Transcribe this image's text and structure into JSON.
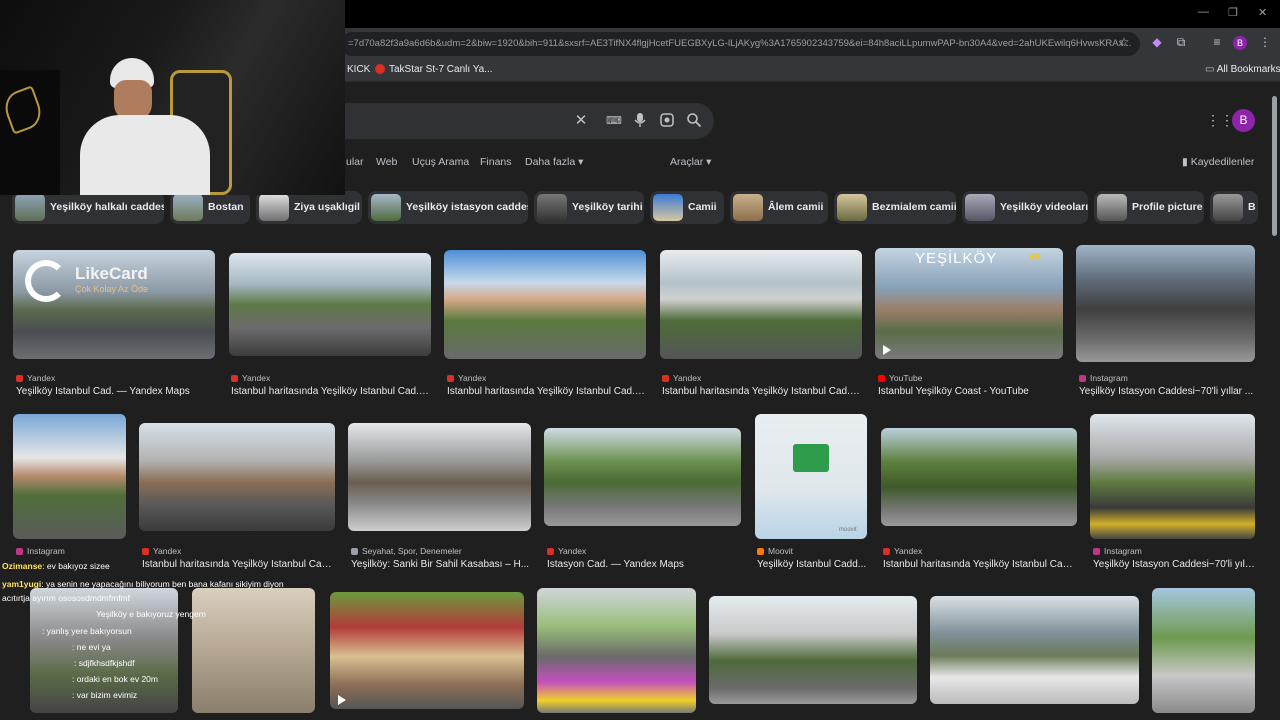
{
  "browser": {
    "url": "=7d70a82f3a9a6d6b&udm=2&biw=1920&bih=911&sxsrf=AE3TifNX4flgjHcetFUEGBXyLG-lLjAKyg%3A1765902343759&ei=84h8aciLLpumwPAP-bn30A4&ved=2ahUKEwilq6HvwsKRAx...",
    "bookmarks": [
      "KICK",
      "TakStar St-7 Canlı Ya..."
    ],
    "all_bookmarks": "All Bookmarks",
    "profile_letter": "B"
  },
  "google": {
    "tabs": [
      "ular",
      "Web",
      "Uçuş Arama",
      "Finans",
      "Daha fazla ▾",
      "Araçlar ▾"
    ],
    "saved": "Kaydedilenler",
    "chips": [
      "Yeşilköy halkalı caddesi",
      "Bostan",
      "Ziya uşaklıgil",
      "Yeşilköy istasyon caddesi",
      "Yeşilköy tarihi",
      "Camii",
      "Âlem camii",
      "Bezmialem camii",
      "Yeşilköy videoları",
      "Profile picture",
      "B"
    ],
    "row1": [
      {
        "source": "Yandex",
        "caption": "Yeşilköy İstanbul Cad. — Yandex Maps",
        "fav": "#d93025"
      },
      {
        "source": "Yandex",
        "caption": "İstanbul haritasında Yeşilköy İstanbul Cad., ...",
        "fav": "#d93025"
      },
      {
        "source": "Yandex",
        "caption": "İstanbul haritasında Yeşilköy İstanbul Cad., ...",
        "fav": "#d93025"
      },
      {
        "source": "Yandex",
        "caption": "İstanbul haritasında Yeşilköy İstanbul Cad., ...",
        "fav": "#d93025"
      },
      {
        "source": "YouTube",
        "caption": "İstanbul Yeşilköy Coast - YouTube",
        "fav": "#ff0000"
      },
      {
        "source": "Instagram",
        "caption": "Yeşilköy İstasyon Caddesi~70'li yıllar ...",
        "fav": "#c13584"
      }
    ],
    "row2": [
      {
        "source": "Instagram",
        "caption": "",
        "fav": "#c13584"
      },
      {
        "source": "Yandex",
        "caption": "İstanbul haritasında Yeşilköy İstanbul Cad. ...",
        "fav": "#d93025"
      },
      {
        "source": "Seyahat, Spor, Denemeler",
        "caption": "Yeşilköy: Sanki Bir Sahil Kasabası – H...",
        "fav": "#9aa0a6"
      },
      {
        "source": "Yandex",
        "caption": "İstasyon Cad. — Yandex Maps",
        "fav": "#d93025"
      },
      {
        "source": "Moovit",
        "caption": "Yeşilköy İstanbul Cadd...",
        "fav": "#f57c00"
      },
      {
        "source": "Yandex",
        "caption": "İstanbul haritasında Yeşilköy İstanbul Cad. ...",
        "fav": "#d93025"
      },
      {
        "source": "Instagram",
        "caption": "Yeşilköy İstasyon Caddesi~70'li yıll...",
        "fav": "#c13584"
      }
    ],
    "watermark": {
      "title": "LikeCard",
      "subtitle": "Çok Kolay Az Öde"
    },
    "youtube_title": "YEŞİLKÖY",
    "youtube_badge": "4K",
    "moovit_logo": "moovit"
  },
  "chat": [
    {
      "user": "Ozimanse",
      "text": ": ev bakıyoz sizee"
    },
    {
      "user": "yam1yugi",
      "text": ": ya senin ne yapacağını biliyorum ben bana kafanı sikiyim diyon"
    },
    {
      "user": "",
      "text": "acıtırtja ayırım osososdmdmfmfmf"
    },
    {
      "user": "",
      "text": "Yeşilköy e bakıyoruz yengem"
    },
    {
      "user": "",
      "text": ": yanlış yere bakıyorsun"
    },
    {
      "user": "",
      "text": ": ne evi ya"
    },
    {
      "user": "",
      "text": ": sdjfkhsdfkjshdf"
    },
    {
      "user": "",
      "text": ": ordaki en bok ev 20m"
    },
    {
      "user": "",
      "text": ": var bizim evimiz"
    },
    {
      "user": "",
      "text": ""
    }
  ]
}
